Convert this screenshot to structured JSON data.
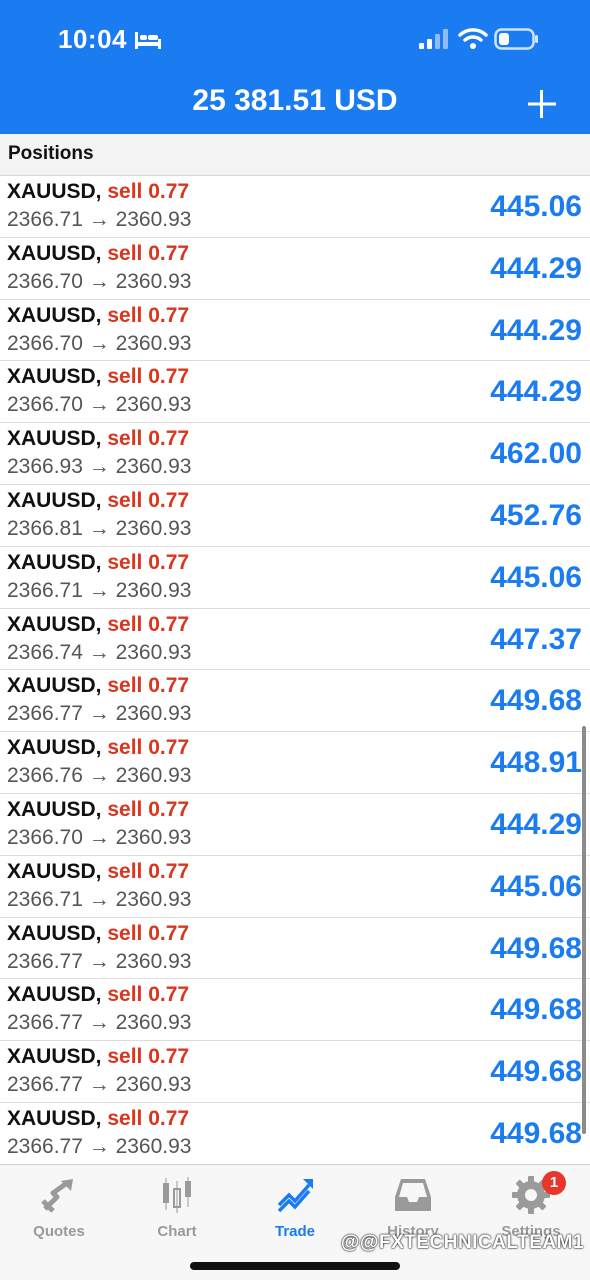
{
  "status_bar": {
    "time": "10:04"
  },
  "header": {
    "balance": "25 381.51 USD"
  },
  "section": {
    "title": "Positions"
  },
  "positions": [
    {
      "symbol": "XAUUSD,",
      "side": "sell 0.77",
      "prices": "2366.71 → 2360.93",
      "profit": "445.06"
    },
    {
      "symbol": "XAUUSD,",
      "side": "sell 0.77",
      "prices": "2366.70 → 2360.93",
      "profit": "444.29"
    },
    {
      "symbol": "XAUUSD,",
      "side": "sell 0.77",
      "prices": "2366.70 → 2360.93",
      "profit": "444.29"
    },
    {
      "symbol": "XAUUSD,",
      "side": "sell 0.77",
      "prices": "2366.70 → 2360.93",
      "profit": "444.29"
    },
    {
      "symbol": "XAUUSD,",
      "side": "sell 0.77",
      "prices": "2366.93 → 2360.93",
      "profit": "462.00"
    },
    {
      "symbol": "XAUUSD,",
      "side": "sell 0.77",
      "prices": "2366.81 → 2360.93",
      "profit": "452.76"
    },
    {
      "symbol": "XAUUSD,",
      "side": "sell 0.77",
      "prices": "2366.71 → 2360.93",
      "profit": "445.06"
    },
    {
      "symbol": "XAUUSD,",
      "side": "sell 0.77",
      "prices": "2366.74 → 2360.93",
      "profit": "447.37"
    },
    {
      "symbol": "XAUUSD,",
      "side": "sell 0.77",
      "prices": "2366.77 → 2360.93",
      "profit": "449.68"
    },
    {
      "symbol": "XAUUSD,",
      "side": "sell 0.77",
      "prices": "2366.76 → 2360.93",
      "profit": "448.91"
    },
    {
      "symbol": "XAUUSD,",
      "side": "sell 0.77",
      "prices": "2366.70 → 2360.93",
      "profit": "444.29"
    },
    {
      "symbol": "XAUUSD,",
      "side": "sell 0.77",
      "prices": "2366.71 → 2360.93",
      "profit": "445.06"
    },
    {
      "symbol": "XAUUSD,",
      "side": "sell 0.77",
      "prices": "2366.77 → 2360.93",
      "profit": "449.68"
    },
    {
      "symbol": "XAUUSD,",
      "side": "sell 0.77",
      "prices": "2366.77 → 2360.93",
      "profit": "449.68"
    },
    {
      "symbol": "XAUUSD,",
      "side": "sell 0.77",
      "prices": "2366.77 → 2360.93",
      "profit": "449.68"
    },
    {
      "symbol": "XAUUSD,",
      "side": "sell 0.77",
      "prices": "2366.77 → 2360.93",
      "profit": "449.68"
    }
  ],
  "tabs": [
    {
      "label": "Quotes",
      "icon": "quotes-icon",
      "active": false
    },
    {
      "label": "Chart",
      "icon": "candlestick-icon",
      "active": false
    },
    {
      "label": "Trade",
      "icon": "trade-icon",
      "active": true
    },
    {
      "label": "History",
      "icon": "inbox-icon",
      "active": false
    },
    {
      "label": "Settings",
      "icon": "gear-icon",
      "active": false,
      "badge": "1"
    }
  ],
  "watermark": "@@FXTECHNICALTEAM1",
  "colors": {
    "accent": "#1a7cf0",
    "sell": "#d9361d",
    "badge": "#e8362b"
  }
}
